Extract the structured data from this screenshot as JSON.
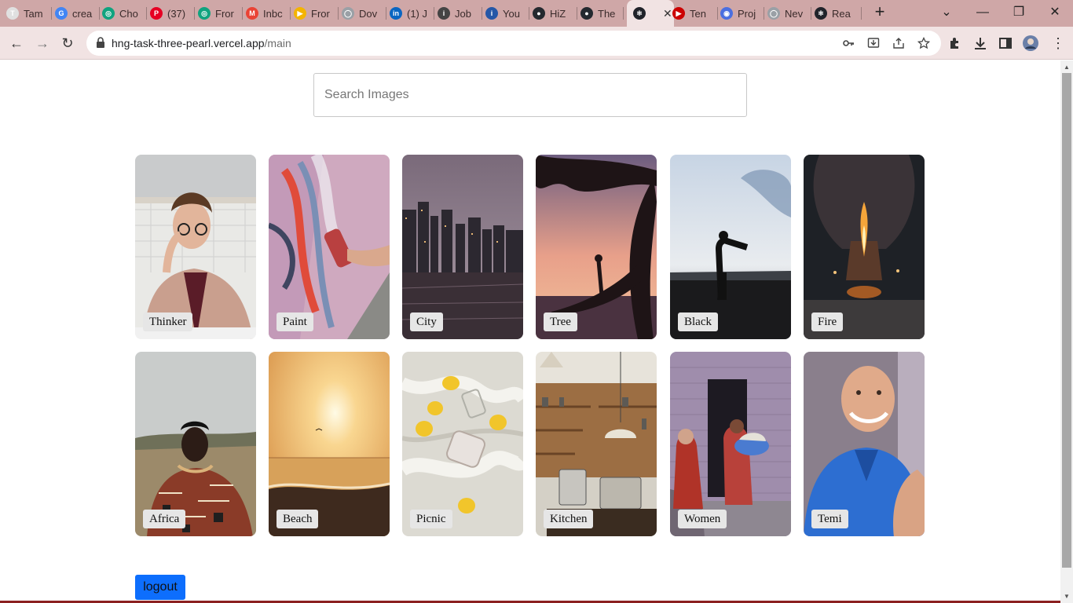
{
  "browser": {
    "tabs": [
      {
        "label": "Tam",
        "icon": "tumblr-icon",
        "color": "#e0e0e0",
        "glyph": "T"
      },
      {
        "label": "crea",
        "icon": "google-icon",
        "color": "#4285f4",
        "glyph": "G"
      },
      {
        "label": "Cho",
        "icon": "chatgpt-icon",
        "color": "#10a37f",
        "glyph": "◎"
      },
      {
        "label": "(37)",
        "icon": "pinterest-icon",
        "color": "#e60023",
        "glyph": "P"
      },
      {
        "label": "Fror",
        "icon": "chatgpt-icon",
        "color": "#10a37f",
        "glyph": "◎"
      },
      {
        "label": "Inbc",
        "icon": "gmail-icon",
        "color": "#ea4335",
        "glyph": "M"
      },
      {
        "label": "Fror",
        "icon": "google-slides-icon",
        "color": "#f4b400",
        "glyph": "▶"
      },
      {
        "label": "Dov",
        "icon": "globe-icon",
        "color": "#9aa0a6",
        "glyph": "◯"
      },
      {
        "label": "(1) J",
        "icon": "linkedin-icon",
        "color": "#0a66c2",
        "glyph": "in"
      },
      {
        "label": "Job",
        "icon": "info-icon",
        "color": "#444",
        "glyph": "i"
      },
      {
        "label": "You",
        "icon": "indeed-icon",
        "color": "#2557a7",
        "glyph": "i"
      },
      {
        "label": "HiZ",
        "icon": "github-icon",
        "color": "#24292f",
        "glyph": "●"
      },
      {
        "label": "The",
        "icon": "github-icon",
        "color": "#24292f",
        "glyph": "●"
      },
      {
        "label": "",
        "icon": "react-icon",
        "color": "#20232a",
        "glyph": "⚛"
      },
      {
        "label": "Ten",
        "icon": "youtube-icon",
        "color": "#c00",
        "glyph": "▶"
      },
      {
        "label": "Proj",
        "icon": "user-icon",
        "color": "#4b6fe0",
        "glyph": "◉"
      },
      {
        "label": "Nev",
        "icon": "globe-icon",
        "color": "#9aa0a6",
        "glyph": "◯"
      },
      {
        "label": "Rea",
        "icon": "react-icon",
        "color": "#20232a",
        "glyph": "⚛"
      }
    ],
    "url_host": "hng-task-three-pearl.vercel.app",
    "url_path": "/main"
  },
  "search": {
    "placeholder": "Search Images"
  },
  "gallery": [
    {
      "label": "Thinker"
    },
    {
      "label": "Paint"
    },
    {
      "label": "City"
    },
    {
      "label": "Tree"
    },
    {
      "label": "Black"
    },
    {
      "label": "Fire"
    },
    {
      "label": "Africa"
    },
    {
      "label": "Beach"
    },
    {
      "label": "Picnic"
    },
    {
      "label": "Kitchen"
    },
    {
      "label": "Women"
    },
    {
      "label": "Temi"
    }
  ],
  "logout_label": "logout",
  "colors": {
    "button": "#0d6efd",
    "tabbar": "#cfa7a7",
    "toolbar": "#f1e3e3"
  }
}
